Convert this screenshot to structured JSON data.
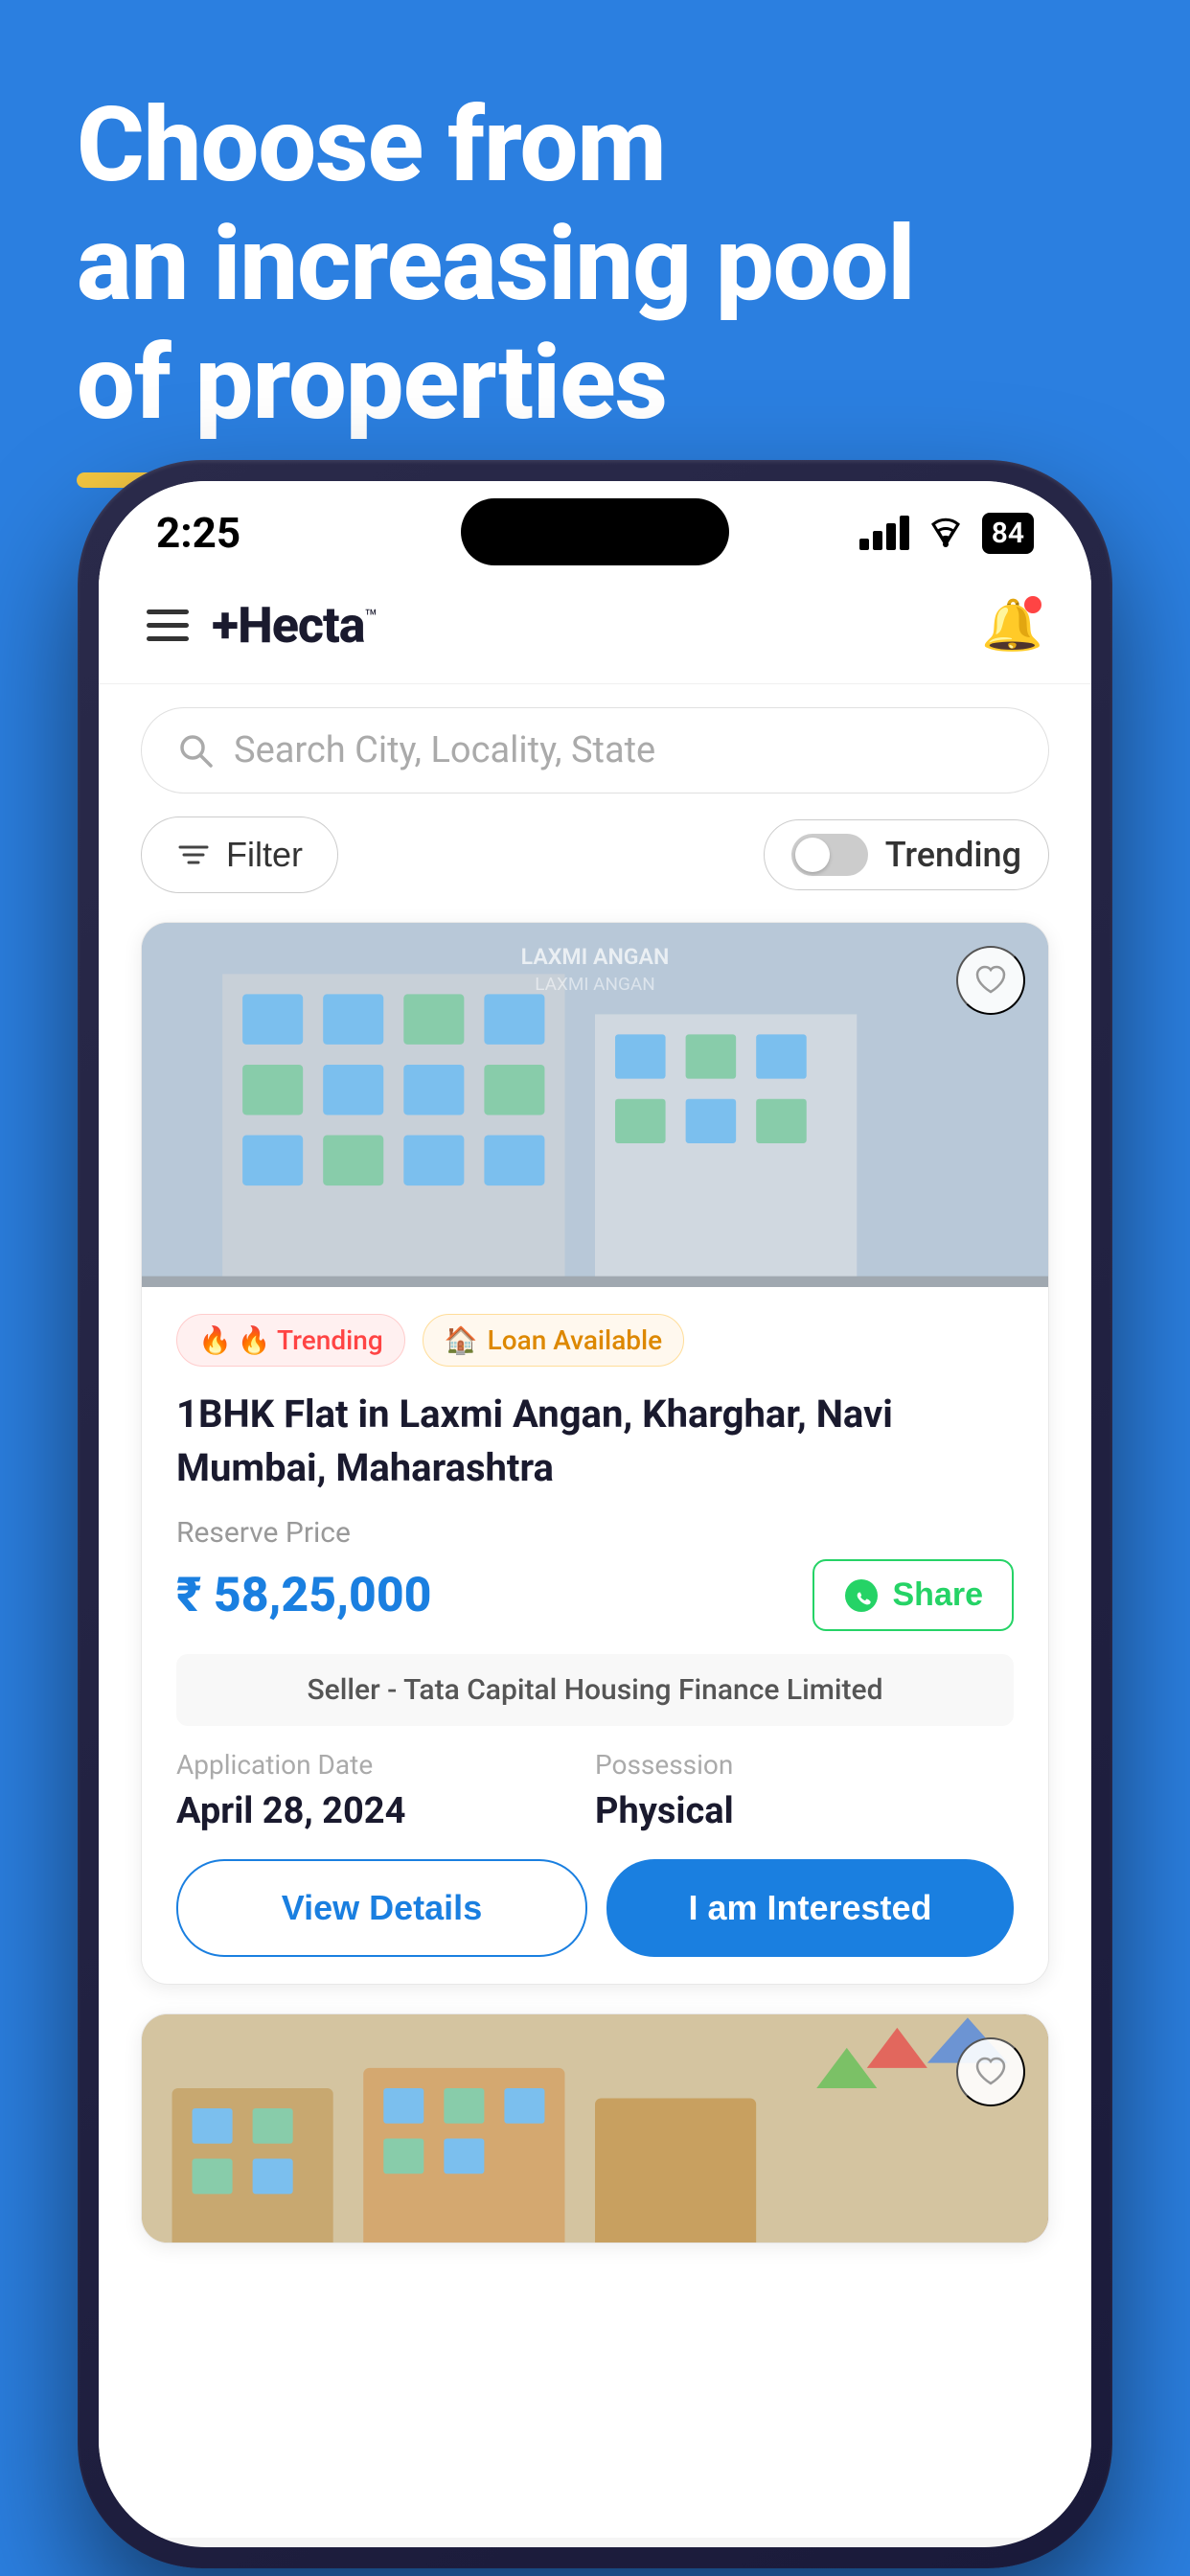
{
  "background_color": "#2B7FE0",
  "hero": {
    "title_line1": "Choose from",
    "title_line2": "an increasing pool",
    "title_line3": "of properties"
  },
  "status_bar": {
    "time": "2:25",
    "battery": "84"
  },
  "header": {
    "logo": "+Hecta",
    "tm": "™",
    "search_placeholder": "Search City, Locality, State"
  },
  "filter_row": {
    "filter_label": "Filter",
    "trending_label": "Trending"
  },
  "property_card": {
    "tag_trending": "🔥 Trending",
    "tag_loan": "🏠 Loan Available",
    "title": "1BHK Flat in Laxmi Angan, Kharghar, Navi Mumbai, Maharashtra",
    "reserve_price_label": "Reserve Price",
    "price": "₹ 58,25,000",
    "share_label": "Share",
    "seller": "Seller - Tata Capital Housing Finance Limited",
    "application_date_label": "Application Date",
    "application_date": "April 28, 2024",
    "possession_label": "Possession",
    "possession": "Physical",
    "view_details_label": "View Details",
    "interested_label": "I am Interested"
  },
  "icons": {
    "hamburger": "☰",
    "bell": "🔔",
    "search": "🔍",
    "heart": "♡",
    "whatsapp": "💬",
    "fire": "🔥",
    "house": "🏠"
  }
}
